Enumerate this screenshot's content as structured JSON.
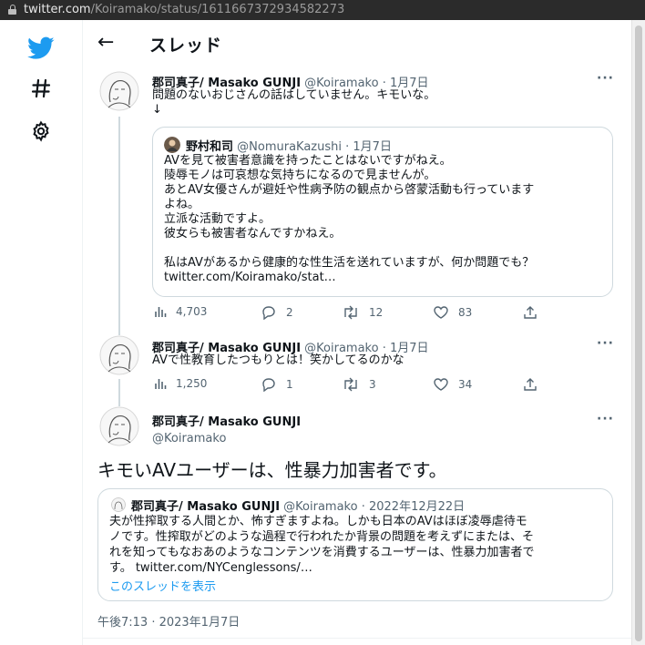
{
  "browser": {
    "url_domain": "twitter.com",
    "url_path": "/Koiramako/status/1611667372934582273"
  },
  "nav": {
    "icons": [
      "twitter-bird-icon",
      "hashtag-icon",
      "gear-icon"
    ]
  },
  "header": {
    "title": "スレッド"
  },
  "tweets": [
    {
      "name": "郡司真子/ Masako GUNJI",
      "handle": "@Koiramako",
      "date": "· 1月7日",
      "text": "問題のないおじさんの話はしていません。キモいな。\n↓",
      "quote": {
        "name": "野村和司",
        "handle": "@NomuraKazushi",
        "date": "· 1月7日",
        "text": "AVを見て被害者意識を持ったことはないですがねえ。\n陵辱モノは可哀想な気持ちになるので見ませんが。\nあとAV女優さんが避妊や性病予防の観点から啓蒙活動も行っています\nよね。\n立派な活動ですよ。\n彼女らも被害者なんですかねえ。\n\n私はAVがあるから健康的な性生活を送れていますが、何か問題でも？\ntwitter.com/Koiramako/stat…"
      },
      "stats": {
        "views": "4,703",
        "replies": "2",
        "retweets": "12",
        "likes": "83"
      }
    },
    {
      "name": "郡司真子/ Masako GUNJI",
      "handle": "@Koiramako",
      "date": "· 1月7日",
      "text": "AVで性教育したつもりとは！笑かしてるのかな",
      "stats": {
        "views": "1,250",
        "replies": "1",
        "retweets": "3",
        "likes": "34"
      }
    }
  ],
  "main_tweet": {
    "name": "郡司真子/ Masako GUNJI",
    "handle": "@Koiramako",
    "text": "キモいAVユーザーは、性暴力加害者です。",
    "quote": {
      "name": "郡司真子/ Masako GUNJI",
      "handle": "@Koiramako",
      "date": "· 2022年12月22日",
      "text": "夫が性搾取する人間とか、怖すぎますよね。しかも日本のAVはほぼ凌辱虐待モ\nノです。性搾取がどのような過程で行われたか背景の問題を考えずにまたは、そ\nれを知ってもなおあのようなコンテンツを消費するユーザーは、性暴力加害者で\nす。 twitter.com/NYCenglessons/…",
      "show_thread": "このスレッドを表示"
    },
    "timestamp": "午後7:13 · 2023年1月7日"
  },
  "colors": {
    "accent": "#1d9bf0",
    "text": "#0f1419",
    "muted": "#536471",
    "border": "#cfd9de"
  }
}
